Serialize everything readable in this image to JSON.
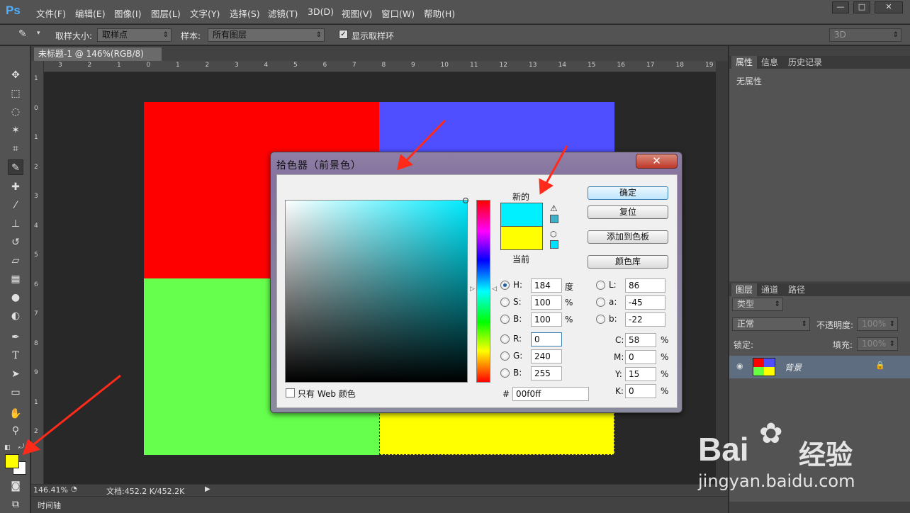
{
  "app": {
    "logo": "Ps"
  },
  "menus": [
    "文件(F)",
    "编辑(E)",
    "图像(I)",
    "图层(L)",
    "文字(Y)",
    "选择(S)",
    "滤镜(T)",
    "3D(D)",
    "视图(V)",
    "窗口(W)",
    "帮助(H)"
  ],
  "options": {
    "sample_size_label": "取样大小:",
    "sample_size_value": "取样点",
    "sample_label": "样本:",
    "sample_value": "所有图层",
    "show_ring_label": "显示取样环",
    "workspace": "3D"
  },
  "document": {
    "tab": "未标题-1 @ 146%(RGB/8) *",
    "zoom": "146.41%",
    "doc_info": "文档:452.2 K/452.2K",
    "timeline": "时间轴",
    "ruler_h": [
      "3",
      "2",
      "1",
      "0",
      "1",
      "2",
      "3",
      "4",
      "5",
      "6",
      "7",
      "8",
      "9",
      "10",
      "11",
      "12",
      "13",
      "14",
      "15",
      "16",
      "17",
      "18",
      "19"
    ],
    "ruler_v": [
      "1",
      "0",
      "1",
      "2",
      "3",
      "4",
      "5",
      "6",
      "7",
      "8",
      "9",
      "1",
      "2"
    ],
    "quadrant_colors": {
      "top_left": "#ff0000",
      "top_right": "#4f4fff",
      "bottom_left": "#66ff4d",
      "bottom_right": "#ffff00"
    }
  },
  "colors": {
    "foreground": "#ffff00",
    "background": "#ffffff"
  },
  "panels": {
    "props_tabs": [
      "属性",
      "信息",
      "历史记录"
    ],
    "props_body": "无属性",
    "layers_tabs": [
      "图层",
      "通道",
      "路径"
    ],
    "kind": "类型",
    "blend": "正常",
    "opacity_label": "不透明度:",
    "opacity": "100%",
    "lock_label": "锁定:",
    "fill_label": "填充:",
    "fill": "100%",
    "layer_name": "背景"
  },
  "dialog": {
    "title": "拾色器（前景色）",
    "ok": "确定",
    "reset": "复位",
    "add_swatch": "添加到色板",
    "libraries": "颜色库",
    "new_label": "新的",
    "current_label": "当前",
    "new_color": "#00f0ff",
    "current_color": "#ffff00",
    "web_only": "只有 Web 颜色",
    "H": "184",
    "S": "100",
    "Bv": "100",
    "R": "0",
    "G": "240",
    "B": "255",
    "L": "86",
    "a": "-45",
    "b": "-22",
    "C": "58",
    "M": "0",
    "Y": "15",
    "K": "0",
    "hex": "00f0ff",
    "deg": "度",
    "pct": "%"
  },
  "watermark": {
    "brand": "Bai",
    "brand2": "经验",
    "url": "jingyan.baidu.com"
  }
}
